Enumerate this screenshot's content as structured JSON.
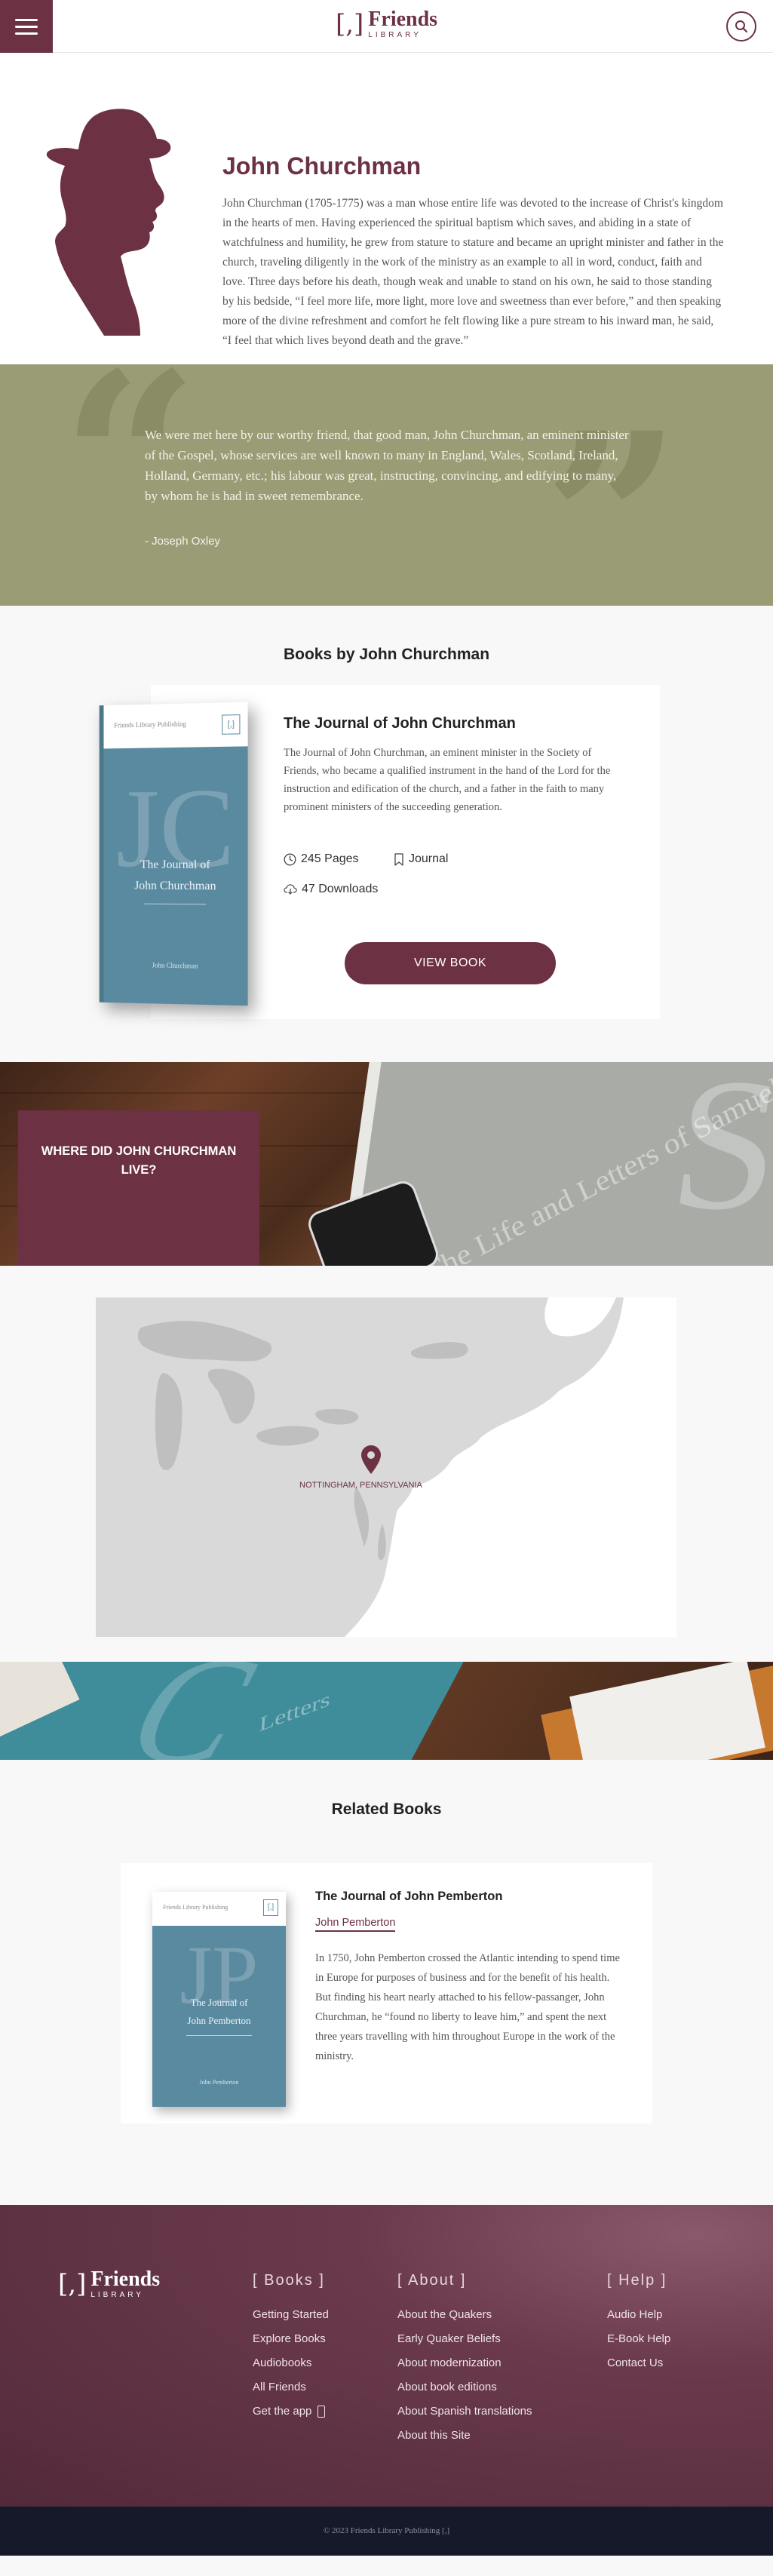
{
  "header": {
    "logo_mark": "[,]",
    "logo_title": "Friends",
    "logo_subtitle": "LIBRARY"
  },
  "author": {
    "name": "John Churchman",
    "bio": "John Churchman (1705-1775) was a man whose entire life was devoted to the increase of Christ's kingdom in the hearts of men. Having experienced the spiritual baptism which saves, and abiding in a state of watchfulness and humility, he grew from stature to stature and became an upright minister and father in the church, traveling diligently in the work of the ministry as an example to all in word, conduct, faith and love. Three days before his death, though weak and unable to stand on his own, he said to those standing by his bedside, “I feel more life, more light, more love and sweetness than ever before,” and then speaking more of the divine refreshment and comfort he felt flowing like a pure stream to his inward man, he said, “I feel that which lives beyond death and the grave.”"
  },
  "quote": {
    "text": "We were met here by our worthy friend, that good man, John Churchman, an eminent minister of the Gospel, whose services are well known to many in England, Wales, Scotland, Ireland, Holland, Germany, etc.; his labour was great, instructing, convincing, and edifying to many, by whom he is had in sweet remembrance.",
    "cite": "- Joseph Oxley"
  },
  "books_section": {
    "title": "Books by John Churchman",
    "book": {
      "title": "The Journal of John Churchman",
      "description": "The Journal of John Churchman, an eminent minister in the Society of Friends, who became a qualified instrument in the hand of the Lord for the instruction and edification of the church, and a father in the faith to many prominent ministers of the succeeding generation.",
      "pages": "245 Pages",
      "type": "Journal",
      "downloads": "47 Downloads",
      "button": "VIEW BOOK",
      "cover": {
        "publisher": "Friends Library Publishing",
        "mark": "[,]",
        "letters": "JC",
        "title_line1": "The Journal of",
        "title_line2": "John Churchman",
        "author": "John Churchman"
      }
    }
  },
  "where": {
    "title": "WHERE DID JOHN CHURCHMAN LIVE?",
    "map_label": "NOTTINGHAM, PENNSYLVANIA",
    "bg_book_letter": "S",
    "bg_book_text": "The Life and Letters of Samuel Fo"
  },
  "teal_banner": {
    "letter": "C",
    "text": "Letters"
  },
  "related": {
    "title": "Related Books",
    "book": {
      "title": "The Journal of John Pemberton",
      "author": "John Pemberton",
      "description": "In 1750, John Pemberton crossed the Atlantic intending to spend time in Europe for purposes of business and for the benefit of his health. But finding his heart nearly attached to his fellow-passanger, John Churchman, he “found no liberty to leave him,” and spent the next three years travelling with him throughout Europe in the work of the ministry.",
      "cover": {
        "publisher": "Friends Library Publishing",
        "mark": "[,]",
        "letters": "JP",
        "title_line1": "The Journal of",
        "title_line2": "John Pemberton",
        "author": "John Pemberton"
      }
    }
  },
  "footer": {
    "logo_mark": "[,]",
    "logo_title": "Friends",
    "logo_subtitle": "LIBRARY",
    "books": {
      "heading": "[ Books ]",
      "links": [
        "Getting Started",
        "Explore Books",
        "Audiobooks",
        "All Friends",
        "Get the app"
      ]
    },
    "about": {
      "heading": "[ About ]",
      "links": [
        "About the Quakers",
        "Early Quaker Beliefs",
        "About modernization",
        "About book editions",
        "About Spanish translations",
        "About this Site"
      ]
    },
    "help": {
      "heading": "[ Help ]",
      "links": [
        "Audio Help",
        "E-Book Help",
        "Contact Us"
      ]
    },
    "copyright": "© 2023 Friends Library Publishing [,]"
  },
  "colors": {
    "brand": "#6c3142",
    "quote_bg": "#9a9c76",
    "cover_teal": "#5a8aa0",
    "copyright_bg": "#15192a"
  }
}
